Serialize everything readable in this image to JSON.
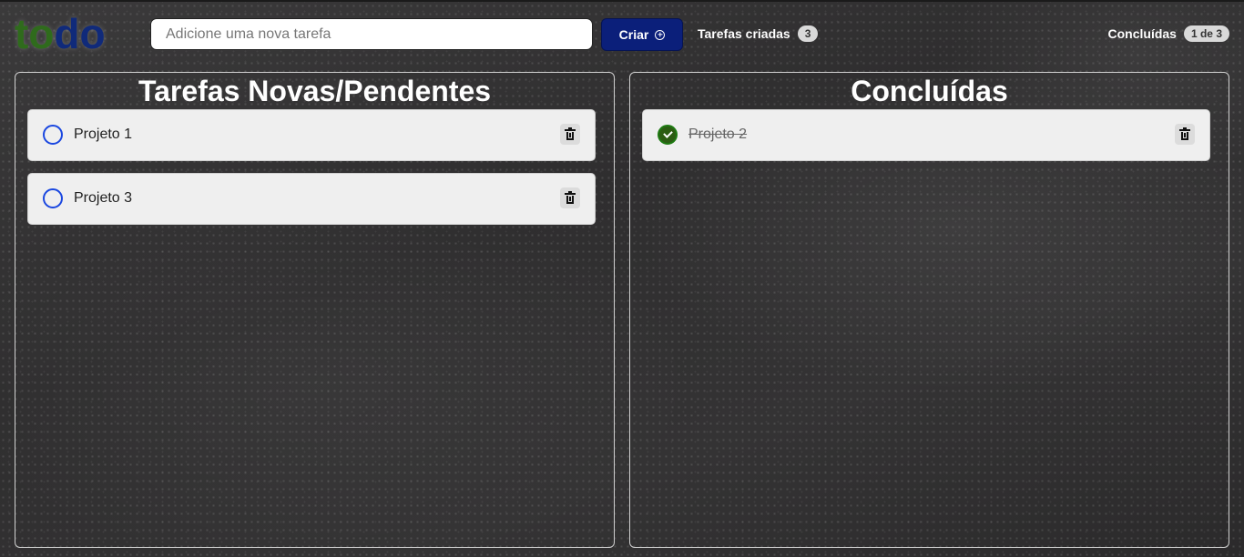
{
  "app": {
    "logo_part1": "to",
    "logo_part2": "do",
    "logo_colors": {
      "to": "#2f6b1c",
      "do": "#102a7a"
    }
  },
  "header": {
    "input_placeholder": "Adicione uma nova tarefa",
    "input_value": "",
    "create_label": "Criar",
    "create_icon": "plus-circle-icon",
    "created_label": "Tarefas criadas",
    "created_count": "3",
    "done_label": "Concluídas",
    "done_count": "1 de 3"
  },
  "pending": {
    "title": "Tarefas Novas/Pendentes",
    "tasks": [
      {
        "text": "Projeto 1",
        "completed": false
      },
      {
        "text": "Projeto 3",
        "completed": false
      }
    ]
  },
  "completed": {
    "title": "Concluídas",
    "tasks": [
      {
        "text": "Projeto 2",
        "completed": true
      }
    ]
  },
  "colors": {
    "accent_button": "#0b1f7a",
    "unchecked_circle": "#1a47e0",
    "checked_circle": "#2b5d12"
  }
}
